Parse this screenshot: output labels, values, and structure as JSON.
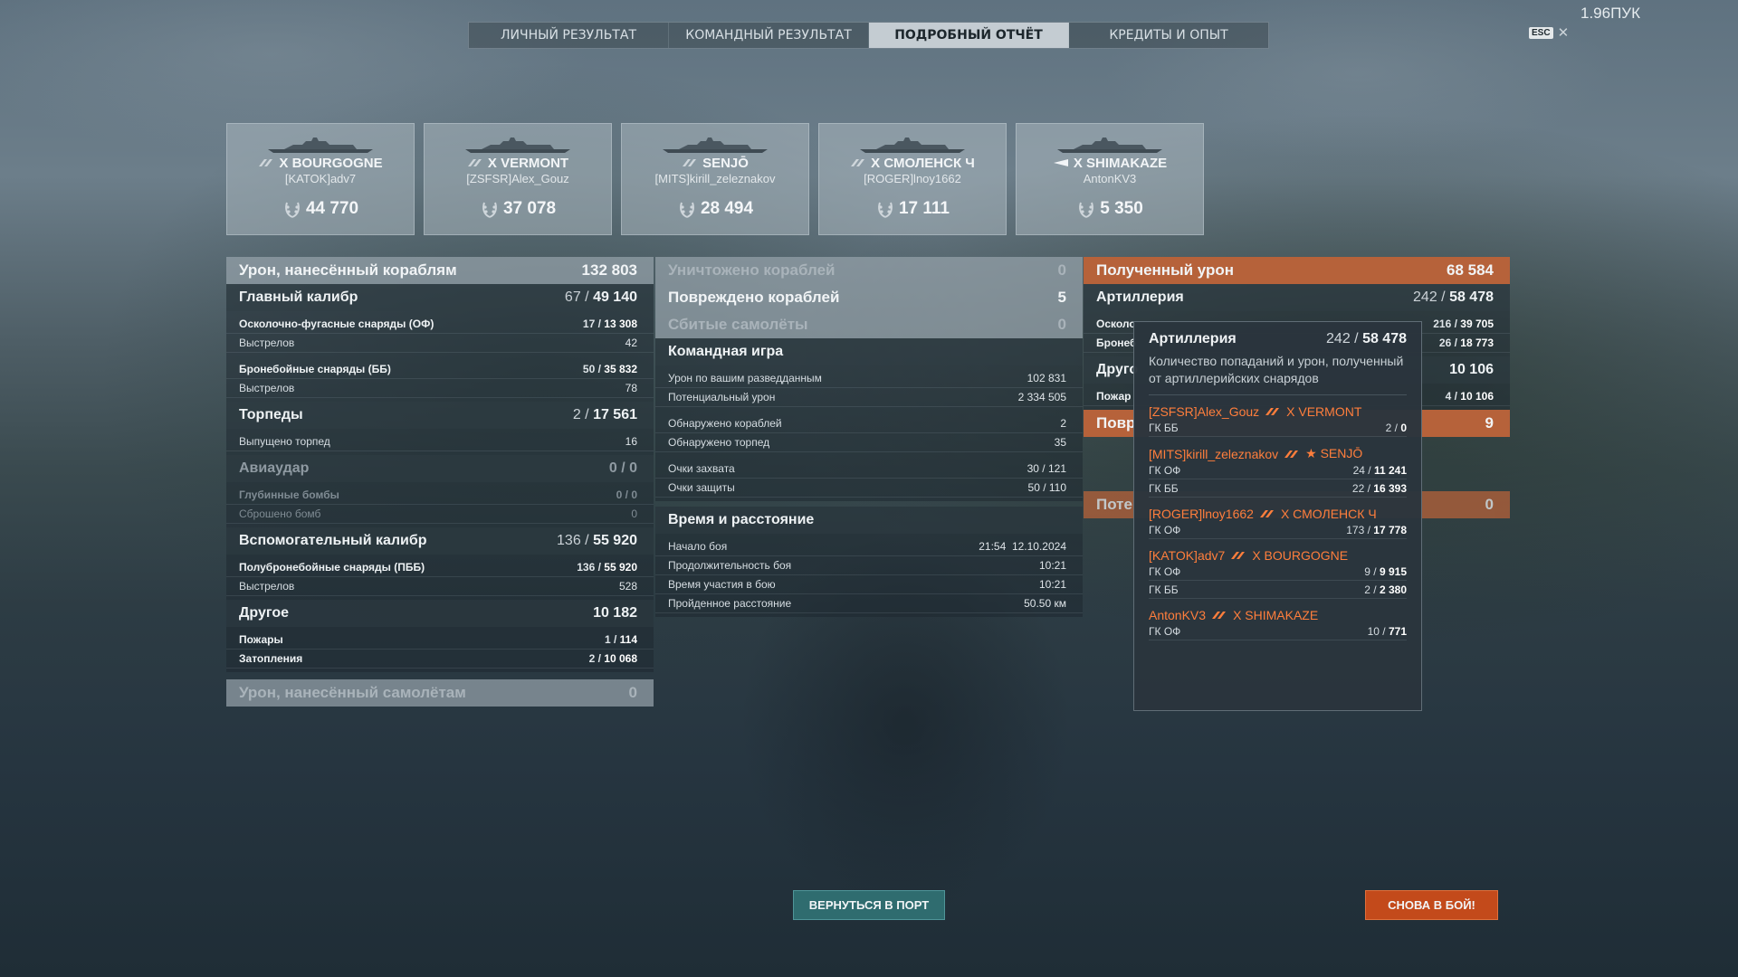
{
  "fps": "1.96ПУК",
  "esc_label": "ESC",
  "close_glyph": "✕",
  "tabs": [
    {
      "label": "ЛИЧНЫЙ РЕЗУЛЬТАТ"
    },
    {
      "label": "КОМАНДНЫЙ РЕЗУЛЬТАТ"
    },
    {
      "label": "ПОДРОБНЫЙ ОТЧЁТ"
    },
    {
      "label": "КРЕДИТЫ И ОПЫТ"
    }
  ],
  "players": [
    {
      "ship": "X BOURGOGNE",
      "name": "[KATOK]adv7",
      "score": "44 770",
      "class_icon": "battleship-icon"
    },
    {
      "ship": "X VERMONT",
      "name": "[ZSFSR]Alex_Gouz",
      "score": "37 078",
      "class_icon": "battleship-icon"
    },
    {
      "ship": "SENJŌ",
      "name": "[MITS]kirill_zeleznakov",
      "score": "28 494",
      "class_icon": "battleship-icon"
    },
    {
      "ship": "X СМОЛЕНСК Ч",
      "name": "[ROGER]lnoy1662",
      "score": "17 111",
      "class_icon": "cruiser-icon"
    },
    {
      "ship": "X SHIMAKAZE",
      "name": "AntonKV3",
      "score": "5 350",
      "class_icon": "destroyer-icon"
    }
  ],
  "left": {
    "damage": {
      "label": "Урон, нанесённый кораблям",
      "value": "132 803"
    },
    "main": {
      "label": "Главный калибр",
      "a": "67",
      "b": "49 140"
    },
    "he": {
      "label": "Осколочно-фугасные снаряды (ОФ)",
      "a": "17",
      "b": "13 308"
    },
    "he_shots": {
      "label": "Выстрелов",
      "value": "42"
    },
    "ap": {
      "label": "Бронебойные снаряды (ББ)",
      "a": "50",
      "b": "35 832"
    },
    "ap_shots": {
      "label": "Выстрелов",
      "value": "78"
    },
    "torp": {
      "label": "Торпеды",
      "a": "2",
      "b": "17 561"
    },
    "torp_fired": {
      "label": "Выпущено торпед",
      "value": "16"
    },
    "air": {
      "label": "Авиаудар",
      "a": "0",
      "b": "0"
    },
    "depth": {
      "label": "Глубинные бомбы",
      "a": "0",
      "b": "0"
    },
    "bombs": {
      "label": "Сброшено бомб",
      "value": "0"
    },
    "sec": {
      "label": "Вспомогательный калибр",
      "a": "136",
      "b": "55 920"
    },
    "sap": {
      "label": "Полубронебойные снаряды (ПББ)",
      "a": "136",
      "b": "55 920"
    },
    "sec_shots": {
      "label": "Выстрелов",
      "value": "528"
    },
    "other": {
      "label": "Другое",
      "value": "10 182"
    },
    "fires": {
      "label": "Пожары",
      "a": "1",
      "b": "114"
    },
    "floods": {
      "label": "Затопления",
      "a": "2",
      "b": "10 068"
    },
    "planes": {
      "label": "Урон, нанесённый самолётам",
      "value": "0"
    }
  },
  "middle": {
    "destroyed": {
      "label": "Уничтожено кораблей",
      "value": "0"
    },
    "damaged": {
      "label": "Повреждено кораблей",
      "value": "5"
    },
    "planes": {
      "label": "Сбитые самолёты",
      "value": "0"
    },
    "team": {
      "label": "Командная игра"
    },
    "spot_dmg": {
      "label": "Урон по вашим разведданным",
      "value": "102 831"
    },
    "pot_dmg": {
      "label": "Потенциальный урон",
      "value": "2 334 505"
    },
    "spot_ships": {
      "label": "Обнаружено кораблей",
      "value": "2"
    },
    "spot_torps": {
      "label": "Обнаружено торпед",
      "value": "35"
    },
    "capture": {
      "label": "Очки захвата",
      "value": "30 / 121"
    },
    "defense": {
      "label": "Очки защиты",
      "value": "50 / 110"
    },
    "time": {
      "label": "Время и расстояние"
    },
    "start": {
      "label": "Начало боя",
      "time": "21:54",
      "date": "12.10.2024"
    },
    "duration": {
      "label": "Продолжительность боя",
      "value": "10:21"
    },
    "participation": {
      "label": "Время участия в бою",
      "value": "10:21"
    },
    "distance": {
      "label": "Пройденное расстояние",
      "value": "50.50 км"
    }
  },
  "right": {
    "received": {
      "label": "Полученный урон",
      "value": "68 584"
    },
    "artillery": {
      "label": "Артиллерия",
      "a": "242",
      "b": "58 478"
    },
    "he_trunc": {
      "label": "Осколо",
      "a": "216",
      "b": "39 705"
    },
    "ap_trunc": {
      "label": "Бронеб",
      "a": "26",
      "b": "18 773"
    },
    "other_trunc": {
      "label": "Друго",
      "value": "10 106"
    },
    "fires_trunc": {
      "label": "Пожар",
      "a": "4",
      "b": "10 106"
    },
    "dmg_trunc": {
      "label": "Повр",
      "value": "9"
    },
    "pot_trunc": {
      "label": "Поте",
      "value": "0"
    }
  },
  "tooltip": {
    "title": "Артиллерия",
    "a": "242",
    "b": "58 478",
    "desc": "Количество попаданий и урон, полученный от артиллерийских снарядов",
    "entries": [
      {
        "player": "[ZSFSR]Alex_Gouz",
        "ship": "X VERMONT",
        "rows": [
          {
            "label": "ГК ББ",
            "a": "2",
            "b": "0"
          }
        ]
      },
      {
        "player": "[MITS]kirill_zeleznakov",
        "ship": "★ SENJŌ",
        "rows": [
          {
            "label": "ГК ОФ",
            "a": "24",
            "b": "11 241"
          },
          {
            "label": "ГК ББ",
            "a": "22",
            "b": "16 393"
          }
        ]
      },
      {
        "player": "[ROGER]lnoy1662",
        "ship": "X СМОЛЕНСК Ч",
        "rows": [
          {
            "label": "ГК ОФ",
            "a": "173",
            "b": "17 778"
          }
        ]
      },
      {
        "player": "[KATOK]adv7",
        "ship": "X BOURGOGNE",
        "rows": [
          {
            "label": "ГК ОФ",
            "a": "9",
            "b": "9 915"
          },
          {
            "label": "ГК ББ",
            "a": "2",
            "b": "2 380"
          }
        ]
      },
      {
        "player": "AntonKV3",
        "ship": "X SHIMAKAZE",
        "rows": [
          {
            "label": "ГК ОФ",
            "a": "10",
            "b": "771"
          }
        ]
      }
    ]
  },
  "buttons": {
    "port": "ВЕРНУТЬСЯ В ПОРТ",
    "battle": "СНОВА В БОЙ!"
  },
  "colors": {
    "accent_orange": "#ff7e3c",
    "button_port": "#2f6c6f",
    "button_battle": "#c34a1b"
  }
}
